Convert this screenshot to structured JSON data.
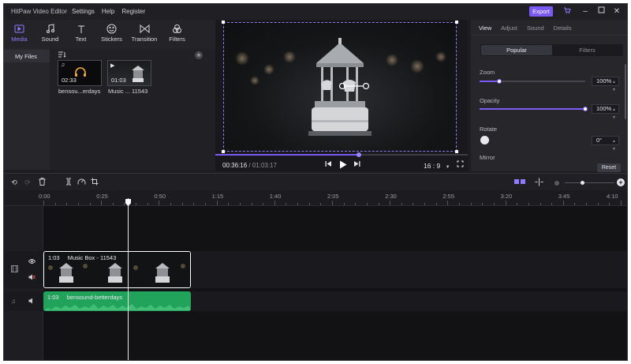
{
  "app": {
    "title": "HitPaw Video Editor",
    "menu": [
      "Settings",
      "Help",
      "Register"
    ],
    "export_label": "Export"
  },
  "media_tools": [
    {
      "label": "Media",
      "icon": "media-icon",
      "active": true
    },
    {
      "label": "Sound",
      "icon": "music-note-icon",
      "active": false
    },
    {
      "label": "Text",
      "icon": "text-icon",
      "active": false
    },
    {
      "label": "Stickers",
      "icon": "sticker-icon",
      "active": false
    },
    {
      "label": "Transition",
      "icon": "transition-icon",
      "active": false
    },
    {
      "label": "Filters",
      "icon": "filters-icon",
      "active": false
    }
  ],
  "media_panel": {
    "my_files": "My Files",
    "items": [
      {
        "name": "bensou...erdays",
        "duration": "02:33",
        "kind": "audio"
      },
      {
        "name": "Music ... 11543",
        "duration": "01:03",
        "kind": "video"
      }
    ]
  },
  "preview": {
    "current_time": "00:36:16",
    "separator": "/",
    "total_time": "01:03:17",
    "aspect_ratio": "16 : 9",
    "progress_fraction": 0.57
  },
  "properties": {
    "tabs": [
      "View",
      "Adjust",
      "Sound",
      "Details"
    ],
    "active_tab": "View",
    "segments": [
      "Popular",
      "Filters"
    ],
    "zoom": {
      "label": "Zoom",
      "value": "100",
      "fraction": 0.19
    },
    "opacity": {
      "label": "Opacity",
      "value": "100",
      "fraction": 1.0
    },
    "rotate": {
      "label": "Rotate",
      "value": "0°"
    },
    "mirror": {
      "label": "Mirror"
    },
    "reset_label": "Reset"
  },
  "timeline": {
    "ruler": [
      "0:00",
      "0:25",
      "0:50",
      "1:15",
      "1:40",
      "2:05",
      "2:30",
      "2:55",
      "3:20",
      "3:45",
      "4:10"
    ],
    "video_clip": {
      "duration": "1:03",
      "title": "Music Box - 11543"
    },
    "audio_clip": {
      "duration": "1:03",
      "title": "bensound-betterdays"
    },
    "zoom_fraction": 0.35
  },
  "colors": {
    "accent": "#7a5af2",
    "audio_clip": "#22a35b",
    "background": "#1d1d22"
  }
}
